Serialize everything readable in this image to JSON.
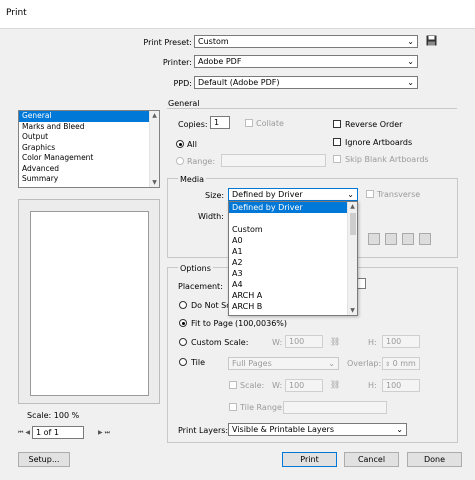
{
  "window": {
    "title": "Print"
  },
  "top": {
    "preset_label": "Print Preset:",
    "preset_value": "Custom",
    "printer_label": "Printer:",
    "printer_value": "Adobe PDF",
    "ppd_label": "PPD:",
    "ppd_value": "Default (Adobe PDF)",
    "icons": {
      "save_preset": "save-icon"
    }
  },
  "sidebar": {
    "items": [
      "General",
      "Marks and Bleed",
      "Output",
      "Graphics",
      "Color Management",
      "Advanced",
      "Summary"
    ],
    "selected_index": 0,
    "scale_label": "Scale: 100 %",
    "page_field": "1 of 1"
  },
  "general": {
    "heading": "General",
    "copies_label": "Copies:",
    "copies_value": "1",
    "collate_label": "Collate",
    "reverse_order_label": "Reverse Order",
    "all_label": "All",
    "range_label": "Range:",
    "ignore_artboards_label": "Ignore Artboards",
    "skip_blank_label": "Skip Blank Artboards"
  },
  "media": {
    "heading": "Media",
    "size_label": "Size:",
    "size_value": "Defined by Driver",
    "transverse_label": "Transverse",
    "width_label": "Width:",
    "size_options": [
      "Defined by Driver",
      "Custom",
      "A0",
      "A1",
      "A2",
      "A3",
      "A4",
      "ARCH A",
      "ARCH B"
    ],
    "size_selected_index": 0
  },
  "options": {
    "heading": "Options",
    "placement_label": "Placement:",
    "do_not_scale_label": "Do Not Sca",
    "fit_to_page_label": "Fit to Page",
    "fit_to_page_value": "(100,0036%)",
    "custom_scale_label": "Custom Scale:",
    "w_label": "W:",
    "h_label": "H:",
    "w_value": "100",
    "h_value": "100",
    "tile_label": "Tile",
    "tile_value": "Full Pages",
    "overlap_label": "Overlap:",
    "overlap_value": "0 mm",
    "scale_label": "Scale:",
    "tile_range_label": "Tile Range:",
    "print_layers_label": "Print Layers:",
    "print_layers_value": "Visible & Printable Layers"
  },
  "buttons": {
    "setup": "Setup...",
    "print": "Print",
    "cancel": "Cancel",
    "done": "Done"
  },
  "colors": {
    "accent": "#0078d7",
    "selection": "#0078d7"
  }
}
